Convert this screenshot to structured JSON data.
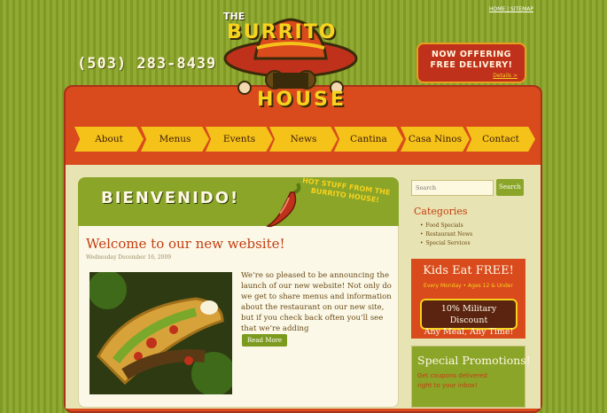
{
  "top_links": {
    "home": "HOME",
    "separator": " | ",
    "sitemap": "SITEMAP"
  },
  "phone": "(503) 283-8439",
  "logo": {
    "the": "THE",
    "burrito": "BURRITO",
    "house": "HOUSE"
  },
  "delivery": {
    "title_line1": "NOW OFFERING",
    "title_line2": "FREE DELIVERY!",
    "link": "Details >"
  },
  "nav": [
    "About",
    "Menus",
    "Events",
    "News",
    "Cantina",
    "Casa Ninos",
    "Contact"
  ],
  "banner": {
    "greeting": "BIENVENIDO!",
    "tagline": "HOT STUFF FROM THE BURRITO HOUSE!"
  },
  "post": {
    "title": "Welcome to our new website!",
    "date": "Wednesday December 16, 2009",
    "body": "We’re so pleased to be announcing the launch of our new website! Not only do we get to share menus and information about the restaurant on our new site, but if you check back often you’ll see that we’re adding",
    "read_more": "Read More"
  },
  "sidebar": {
    "search_placeholder": "Search",
    "search_button": "Search",
    "categories_title": "Categories",
    "categories": [
      "Food Specials",
      "Restaurant News",
      "Special Services"
    ],
    "kids": {
      "title": "Kids Eat FREE!",
      "subtitle": "Every Monday • Ages 12 & Under"
    },
    "military": {
      "line1": "10% Military Discount",
      "line2": "Any Meal, Any Time!"
    },
    "promo": {
      "title": "Special Promotions!",
      "subtitle": "Get coupons delivered right to your inbox!"
    }
  },
  "colors": {
    "background": "#8aa528",
    "panel": "#d94a1c",
    "accent": "#f5c21a",
    "content": "#fbf8e8"
  }
}
